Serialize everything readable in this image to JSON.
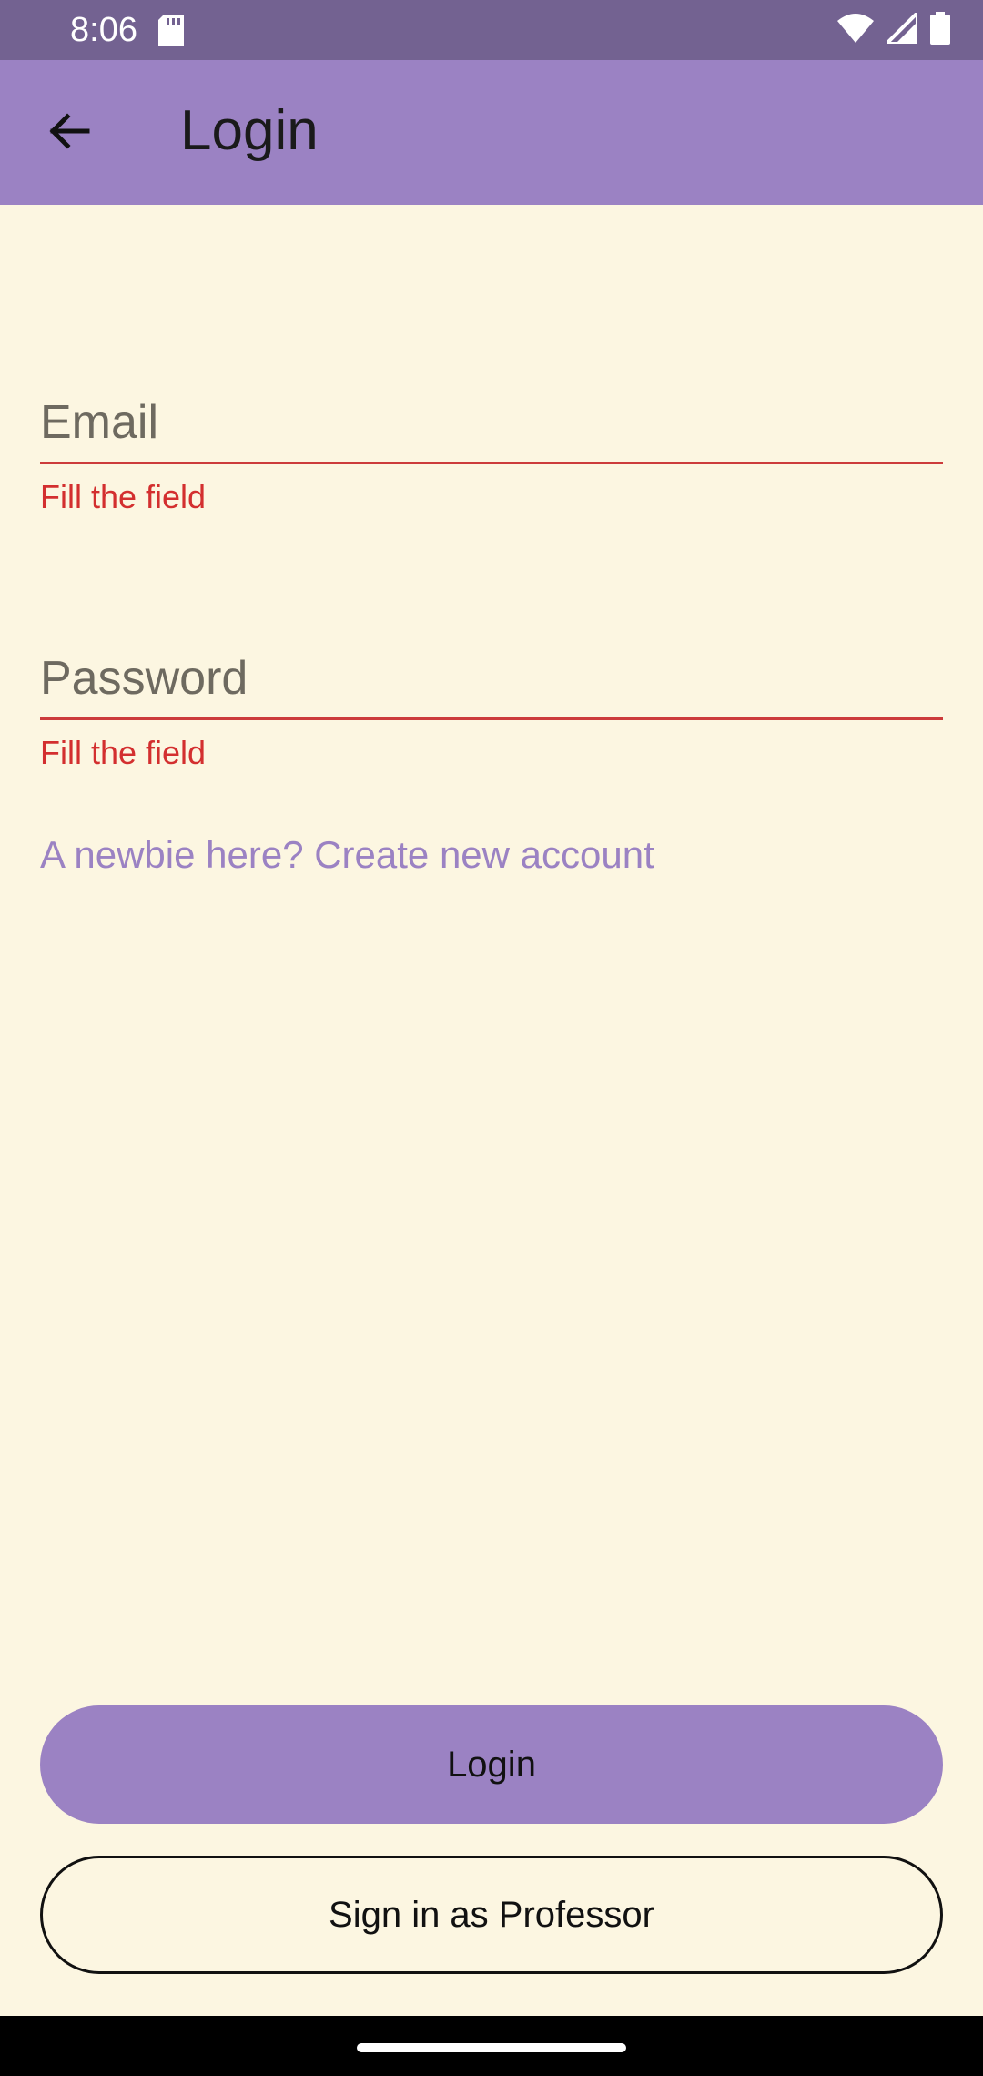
{
  "status_bar": {
    "time": "8:06",
    "icons": [
      "sd-card-icon",
      "wifi-icon",
      "cell-signal-icon",
      "battery-icon"
    ],
    "background": "#736291"
  },
  "app_bar": {
    "title": "Login",
    "back_icon": "arrow-back-icon",
    "background": "#9b82c3"
  },
  "form": {
    "email": {
      "placeholder": "Email",
      "value": "",
      "error": "Fill the field"
    },
    "password": {
      "placeholder": "Password",
      "value": "",
      "error": "Fill the field"
    },
    "create_account_link": "A newbie here? Create new account"
  },
  "actions": {
    "login_label": "Login",
    "professor_label": "Sign in as Professor"
  },
  "colors": {
    "accent": "#9b82c3",
    "error": "#d32f2f",
    "background": "#fcf6e1"
  }
}
